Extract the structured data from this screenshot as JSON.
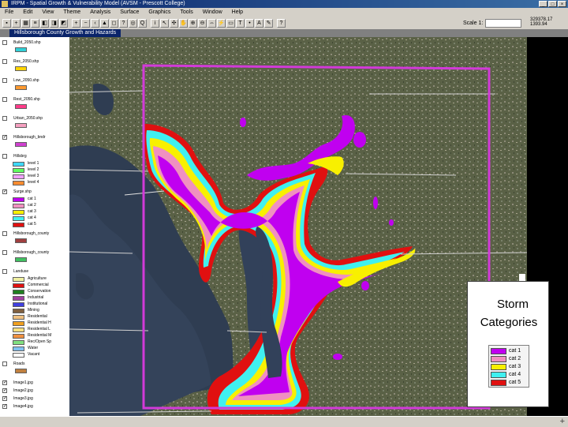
{
  "window": {
    "title": "IRPM - Spatial Growth & Vulnerability Model (AVSM - Prescott College)"
  },
  "menu": [
    "File",
    "Edit",
    "View",
    "Theme",
    "Analysis",
    "Surface",
    "Graphics",
    "Tools",
    "Window",
    "Help"
  ],
  "toolbar": {
    "scale_label": "Scale 1:",
    "coords": [
      "329378.17",
      "1393.94"
    ]
  },
  "map_window": {
    "title": "Hillsborough County Growth and Hazards"
  },
  "toc": {
    "layers": [
      {
        "name": "Build_2050.shp",
        "checked": false,
        "swatch": "#2fd0d8"
      },
      {
        "name": "Res_2050.shp",
        "checked": false,
        "swatch": "#ffd400"
      },
      {
        "name": "Low_2050.shp",
        "checked": false,
        "swatch": "#ff9a30"
      },
      {
        "name": "Rest_2050.shp",
        "checked": false,
        "swatch": "#ff3b8a"
      },
      {
        "name": "Urban_2050.shp",
        "checked": false,
        "swatch": "#f6a0c0"
      },
      {
        "name": "Hillsborough_bndr",
        "checked": true,
        "swatch": "#d040d0"
      },
      {
        "name": "Hillsbrg",
        "checked": false,
        "classes": [
          {
            "label": "level 1",
            "color": "#3fd9ff"
          },
          {
            "label": "level 2",
            "color": "#60ff60"
          },
          {
            "label": "level 3",
            "color": "#f0a0ff"
          },
          {
            "label": "level 4",
            "color": "#ff8c30"
          }
        ]
      },
      {
        "name": "Surge.shp",
        "checked": true,
        "classes": [
          {
            "label": "cat 1",
            "color": "#c000f0"
          },
          {
            "label": "cat 2",
            "color": "#f090c0"
          },
          {
            "label": "cat 3",
            "color": "#f8f000"
          },
          {
            "label": "cat 4",
            "color": "#40f0f0"
          },
          {
            "label": "cat 5",
            "color": "#e01010"
          }
        ]
      },
      {
        "name": "Hillsborough_county",
        "checked": false,
        "swatch": "#a04040"
      },
      {
        "name": "Hillsborough_county",
        "checked": false,
        "swatch": "#40c060"
      },
      {
        "name": "Landuse",
        "checked": false,
        "classes": [
          {
            "label": "Agriculture",
            "color": "#f0f0a0"
          },
          {
            "label": "Commercial",
            "color": "#e01010"
          },
          {
            "label": "Conservation",
            "color": "#208020"
          },
          {
            "label": "Industrial",
            "color": "#a040a0"
          },
          {
            "label": "Institutional",
            "color": "#4040e0"
          },
          {
            "label": "Mining",
            "color": "#806040"
          },
          {
            "label": "Residential",
            "color": "#f0c080"
          },
          {
            "label": "Residential H",
            "color": "#f0a020"
          },
          {
            "label": "Residential L",
            "color": "#f8e080"
          },
          {
            "label": "Residential M",
            "color": "#f09040"
          },
          {
            "label": "Rec/Open Sp",
            "color": "#80e080"
          },
          {
            "label": "Water",
            "color": "#80c0f0"
          },
          {
            "label": "Vacant",
            "color": "#ffffff"
          }
        ]
      },
      {
        "name": "Roads",
        "checked": false,
        "swatch": "#c08040"
      },
      {
        "name": "Image1.jpg",
        "checked": true
      },
      {
        "name": "Image2.jpg",
        "checked": true
      },
      {
        "name": "Image3.jpg",
        "checked": true
      },
      {
        "name": "Image4.jpg",
        "checked": true
      }
    ]
  },
  "legend": {
    "title_line1": "Storm",
    "title_line2": "Categories",
    "items": [
      {
        "label": "cat 1",
        "color": "#c000f0"
      },
      {
        "label": "cat 2",
        "color": "#f090c0"
      },
      {
        "label": "cat 3",
        "color": "#f8f000"
      },
      {
        "label": "cat 4",
        "color": "#40f0f0"
      },
      {
        "label": "cat 5",
        "color": "#e01010"
      }
    ]
  },
  "colors": {
    "boundary": "#d23ad8",
    "water": "#2f3d52",
    "land": "#5b6347"
  }
}
